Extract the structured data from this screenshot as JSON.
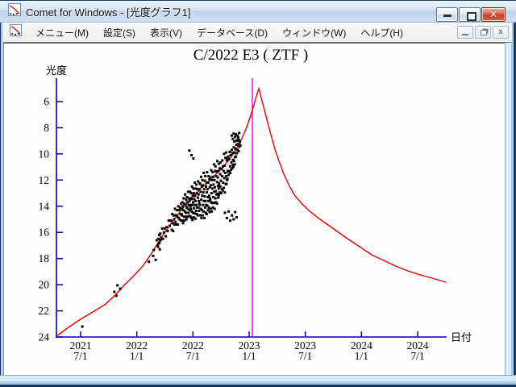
{
  "window": {
    "title": "Comet for Windows - [光度グラフ1]",
    "app_icon": "comet-lightcurve-icon"
  },
  "menu": {
    "items": [
      {
        "label": "メニュー(M)"
      },
      {
        "label": "設定(S)"
      },
      {
        "label": "表示(V)"
      },
      {
        "label": "データベース(D)"
      },
      {
        "label": "ウィンドウ(W)"
      },
      {
        "label": "ヘルプ(H)"
      }
    ]
  },
  "colors": {
    "titlebar_gradient_top": "#eaf3fc",
    "titlebar_gradient_bottom": "#bed4ec",
    "close_button": "#c93f27",
    "menubar_bg": "#f4f3f2",
    "client_bg": "#fefefe",
    "frame_blue": "#a9c7e2"
  },
  "chart_data": {
    "type": "scatter",
    "title": "C/2022 E3 ( ZTF )",
    "xlabel": "日付",
    "ylabel": "光度",
    "x_unit": "decimal_year",
    "xlim": [
      2021.285,
      2024.758
    ],
    "ylim_mag": [
      24.06,
      4.21
    ],
    "grid": false,
    "legend": "none",
    "axis_color": "#0000bb",
    "curve_color": "#e10000",
    "marker_color": "#000000",
    "y_ticks": [
      6,
      8,
      10,
      12,
      14,
      16,
      18,
      20,
      22,
      24
    ],
    "x_ticks": [
      {
        "t": 2021.5,
        "line1": "2021",
        "line2": "7/1"
      },
      {
        "t": 2022.0,
        "line1": "2022",
        "line2": "1/1"
      },
      {
        "t": 2022.5,
        "line1": "2022",
        "line2": "7/1"
      },
      {
        "t": 2023.0,
        "line1": "2023",
        "line2": "1/1"
      },
      {
        "t": 2023.5,
        "line1": "2023",
        "line2": "7/1"
      },
      {
        "t": 2024.0,
        "line1": "2024",
        "line2": "1/1"
      },
      {
        "t": 2024.5,
        "line1": "2024",
        "line2": "7/1"
      }
    ],
    "perihelion_line": {
      "t": 2023.029,
      "color": "#ff00ff"
    },
    "model_curve": [
      [
        2021.285,
        23.94
      ],
      [
        2021.392,
        23.26
      ],
      [
        2021.5,
        22.64
      ],
      [
        2021.608,
        22.09
      ],
      [
        2021.715,
        21.53
      ],
      [
        2021.809,
        20.79
      ],
      [
        2021.895,
        19.99
      ],
      [
        2021.981,
        19.25
      ],
      [
        2022.06,
        18.51
      ],
      [
        2022.132,
        17.59
      ],
      [
        2022.189,
        16.79
      ],
      [
        2022.246,
        16.05
      ],
      [
        2022.311,
        15.25
      ],
      [
        2022.376,
        14.51
      ],
      [
        2022.44,
        13.83
      ],
      [
        2022.505,
        13.21
      ],
      [
        2022.569,
        12.66
      ],
      [
        2022.634,
        12.17
      ],
      [
        2022.698,
        11.61
      ],
      [
        2022.763,
        11.06
      ],
      [
        2022.828,
        10.38
      ],
      [
        2022.885,
        9.64
      ],
      [
        2022.935,
        8.84
      ],
      [
        2022.978,
        7.97
      ],
      [
        2023.014,
        7.05
      ],
      [
        2023.043,
        6.25
      ],
      [
        2023.065,
        5.57
      ],
      [
        2023.086,
        5.01
      ],
      [
        2023.108,
        5.69
      ],
      [
        2023.136,
        6.62
      ],
      [
        2023.165,
        7.6
      ],
      [
        2023.194,
        8.53
      ],
      [
        2023.23,
        9.64
      ],
      [
        2023.266,
        10.56
      ],
      [
        2023.309,
        11.55
      ],
      [
        2023.359,
        12.47
      ],
      [
        2023.409,
        13.21
      ],
      [
        2023.466,
        13.77
      ],
      [
        2023.531,
        14.32
      ],
      [
        2023.603,
        14.82
      ],
      [
        2023.682,
        15.31
      ],
      [
        2023.775,
        15.86
      ],
      [
        2023.876,
        16.48
      ],
      [
        2023.983,
        17.1
      ],
      [
        2024.091,
        17.71
      ],
      [
        2024.199,
        18.15
      ],
      [
        2024.306,
        18.58
      ],
      [
        2024.414,
        18.95
      ],
      [
        2024.522,
        19.25
      ],
      [
        2024.63,
        19.5
      ],
      [
        2024.752,
        19.81
      ]
    ],
    "observations": [
      [
        2021.515,
        23.2
      ],
      [
        2021.8,
        20.55
      ],
      [
        2021.828,
        20.05
      ],
      [
        2021.852,
        20.3
      ],
      [
        2021.818,
        20.85
      ],
      [
        2022.108,
        18.25
      ],
      [
        2022.146,
        17.8
      ],
      [
        2022.168,
        18.1
      ],
      [
        2022.152,
        17.35
      ],
      [
        2022.185,
        17.0
      ],
      [
        2022.177,
        16.6
      ],
      [
        2022.19,
        17.1
      ],
      [
        2022.197,
        16.85
      ],
      [
        2022.205,
        17.3
      ],
      [
        2022.212,
        16.6
      ],
      [
        2022.2,
        16.2
      ],
      [
        2022.192,
        16.5
      ],
      [
        2022.201,
        16.8
      ],
      [
        2022.209,
        16.1
      ],
      [
        2022.218,
        16.4
      ],
      [
        2022.226,
        15.7
      ],
      [
        2022.233,
        16.5
      ],
      [
        2022.241,
        16.0
      ],
      [
        2022.249,
        15.7
      ],
      [
        2022.258,
        16.3
      ],
      [
        2022.266,
        15.6
      ],
      [
        2022.275,
        15.9
      ],
      [
        2022.284,
        15.1
      ],
      [
        2022.293,
        15.5
      ],
      [
        2022.304,
        15.1
      ],
      [
        2022.312,
        15.8
      ],
      [
        2022.316,
        14.6
      ],
      [
        2022.32,
        15.3
      ],
      [
        2022.324,
        15.9
      ],
      [
        2022.328,
        14.7
      ],
      [
        2022.332,
        15.0
      ],
      [
        2022.336,
        15.4
      ],
      [
        2022.34,
        14.2
      ],
      [
        2022.345,
        15.2
      ],
      [
        2022.349,
        14.7
      ],
      [
        2022.353,
        15.4
      ],
      [
        2022.357,
        14.3
      ],
      [
        2022.361,
        14.8
      ],
      [
        2022.365,
        15.4
      ],
      [
        2022.369,
        14.0
      ],
      [
        2022.373,
        14.9
      ],
      [
        2022.377,
        14.3
      ],
      [
        2022.381,
        15.0
      ],
      [
        2022.385,
        14.1
      ],
      [
        2022.389,
        14.6
      ],
      [
        2022.392,
        15.1
      ],
      [
        2022.395,
        13.8
      ],
      [
        2022.398,
        14.6
      ],
      [
        2022.4,
        14.2
      ],
      [
        2022.402,
        14.7
      ],
      [
        2022.405,
        13.7
      ],
      [
        2022.407,
        15.1
      ],
      [
        2022.41,
        14.0
      ],
      [
        2022.412,
        15.3
      ],
      [
        2022.415,
        14.3
      ],
      [
        2022.417,
        13.4
      ],
      [
        2022.42,
        14.8
      ],
      [
        2022.422,
        13.8
      ],
      [
        2022.425,
        15.1
      ],
      [
        2022.427,
        14.4
      ],
      [
        2022.43,
        13.1
      ],
      [
        2022.432,
        14.8
      ],
      [
        2022.435,
        13.9
      ],
      [
        2022.437,
        14.5
      ],
      [
        2022.44,
        13.5
      ],
      [
        2022.442,
        15.0
      ],
      [
        2022.445,
        14.1
      ],
      [
        2022.447,
        13.3
      ],
      [
        2022.45,
        14.8
      ],
      [
        2022.452,
        13.7
      ],
      [
        2022.455,
        14.2
      ],
      [
        2022.457,
        12.9
      ],
      [
        2022.46,
        14.5
      ],
      [
        2022.462,
        13.9
      ],
      [
        2022.465,
        13.4
      ],
      [
        2022.467,
        14.75
      ],
      [
        2022.47,
        13.6
      ],
      [
        2022.472,
        14.3
      ],
      [
        2022.475,
        12.9
      ],
      [
        2022.477,
        14.0
      ],
      [
        2022.479,
        14.8
      ],
      [
        2022.48,
        13.4
      ],
      [
        2022.481,
        13.9
      ],
      [
        2022.468,
        9.75
      ],
      [
        2022.487,
        10.1
      ],
      [
        2022.503,
        10.35
      ],
      [
        2022.482,
        14.2
      ],
      [
        2022.484,
        13.0
      ],
      [
        2022.486,
        14.9
      ],
      [
        2022.488,
        13.45
      ],
      [
        2022.49,
        14.4
      ],
      [
        2022.492,
        12.5
      ],
      [
        2022.494,
        13.9
      ],
      [
        2022.496,
        15.05
      ],
      [
        2022.498,
        13.2
      ],
      [
        2022.5,
        14.5
      ],
      [
        2022.502,
        13.7
      ],
      [
        2022.504,
        12.65
      ],
      [
        2022.506,
        14.85
      ],
      [
        2022.508,
        13.0
      ],
      [
        2022.51,
        14.15
      ],
      [
        2022.512,
        13.45
      ],
      [
        2022.514,
        14.55
      ],
      [
        2022.516,
        12.2
      ],
      [
        2022.518,
        13.9
      ],
      [
        2022.52,
        13.2
      ],
      [
        2022.522,
        14.95
      ],
      [
        2022.524,
        13.6
      ],
      [
        2022.526,
        12.65
      ],
      [
        2022.528,
        14.35
      ],
      [
        2022.53,
        12.35
      ],
      [
        2022.532,
        13.9
      ],
      [
        2022.534,
        14.6
      ],
      [
        2022.536,
        13.0
      ],
      [
        2022.538,
        14.1
      ],
      [
        2022.54,
        12.7
      ],
      [
        2022.542,
        14.7
      ],
      [
        2022.544,
        13.35
      ],
      [
        2022.546,
        12.1
      ],
      [
        2022.548,
        14.1
      ],
      [
        2022.55,
        13.1
      ],
      [
        2022.552,
        13.6
      ],
      [
        2022.554,
        14.35
      ],
      [
        2022.556,
        12.7
      ],
      [
        2022.558,
        13.8
      ],
      [
        2022.56,
        12.25
      ],
      [
        2022.562,
        13.9
      ],
      [
        2022.564,
        12.3
      ],
      [
        2022.566,
        14.7
      ],
      [
        2022.568,
        12.9
      ],
      [
        2022.57,
        14.2
      ],
      [
        2022.572,
        11.75
      ],
      [
        2022.574,
        13.5
      ],
      [
        2022.576,
        14.9
      ],
      [
        2022.578,
        12.5
      ],
      [
        2022.58,
        14.3
      ],
      [
        2022.582,
        13.2
      ],
      [
        2022.584,
        12.0
      ],
      [
        2022.586,
        14.7
      ],
      [
        2022.588,
        12.4
      ],
      [
        2022.59,
        13.9
      ],
      [
        2022.592,
        12.95
      ],
      [
        2022.594,
        14.4
      ],
      [
        2022.596,
        11.45
      ],
      [
        2022.598,
        13.6
      ],
      [
        2022.6,
        12.7
      ],
      [
        2022.602,
        14.9
      ],
      [
        2022.604,
        13.25
      ],
      [
        2022.606,
        12.05
      ],
      [
        2022.608,
        14.1
      ],
      [
        2022.61,
        11.7
      ],
      [
        2022.612,
        13.6
      ],
      [
        2022.614,
        14.5
      ],
      [
        2022.616,
        12.5
      ],
      [
        2022.618,
        13.9
      ],
      [
        2022.62,
        12.2
      ],
      [
        2022.622,
        14.6
      ],
      [
        2022.624,
        12.95
      ],
      [
        2022.626,
        11.4
      ],
      [
        2022.628,
        13.95
      ],
      [
        2022.63,
        12.7
      ],
      [
        2022.632,
        13.3
      ],
      [
        2022.634,
        14.3
      ],
      [
        2022.636,
        12.2
      ],
      [
        2022.638,
        13.6
      ],
      [
        2022.64,
        11.7
      ],
      [
        2022.642,
        14.1
      ],
      [
        2022.644,
        13.2
      ],
      [
        2022.646,
        11.95
      ],
      [
        2022.648,
        14.45
      ],
      [
        2022.65,
        12.55
      ],
      [
        2022.651,
        13.4
      ],
      [
        2022.653,
        13.5
      ],
      [
        2022.655,
        11.8
      ],
      [
        2022.657,
        14.2
      ],
      [
        2022.659,
        12.4
      ],
      [
        2022.661,
        13.7
      ],
      [
        2022.663,
        11.25
      ],
      [
        2022.665,
        13.0
      ],
      [
        2022.667,
        14.4
      ],
      [
        2022.669,
        12.0
      ],
      [
        2022.671,
        13.75
      ],
      [
        2022.673,
        12.65
      ],
      [
        2022.675,
        11.4
      ],
      [
        2022.677,
        14.1
      ],
      [
        2022.679,
        11.75
      ],
      [
        2022.681,
        13.3
      ],
      [
        2022.683,
        12.35
      ],
      [
        2022.685,
        13.75
      ],
      [
        2022.687,
        10.8
      ],
      [
        2022.689,
        12.9
      ],
      [
        2022.691,
        12.0
      ],
      [
        2022.693,
        14.2
      ],
      [
        2022.695,
        12.55
      ],
      [
        2022.697,
        11.3
      ],
      [
        2022.699,
        13.4
      ],
      [
        2022.701,
        10.95
      ],
      [
        2022.703,
        12.85
      ],
      [
        2022.705,
        13.7
      ],
      [
        2022.707,
        11.7
      ],
      [
        2022.709,
        13.1
      ],
      [
        2022.711,
        11.35
      ],
      [
        2022.713,
        13.8
      ],
      [
        2022.715,
        12.15
      ],
      [
        2022.717,
        10.55
      ],
      [
        2022.719,
        13.05
      ],
      [
        2022.721,
        11.8
      ],
      [
        2022.723,
        12.45
      ],
      [
        2022.725,
        13.35
      ],
      [
        2022.727,
        11.3
      ],
      [
        2022.729,
        12.65
      ],
      [
        2022.73,
        10.75
      ],
      [
        2022.731,
        13.15
      ],
      [
        2022.732,
        12.25
      ],
      [
        2022.734,
        12.45
      ],
      [
        2022.737,
        11.1
      ],
      [
        2022.739,
        12.95
      ],
      [
        2022.742,
        11.55
      ],
      [
        2022.744,
        12.5
      ],
      [
        2022.747,
        10.65
      ],
      [
        2022.749,
        12.05
      ],
      [
        2022.752,
        13.0
      ],
      [
        2022.754,
        11.15
      ],
      [
        2022.757,
        12.7
      ],
      [
        2022.759,
        11.7
      ],
      [
        2022.762,
        10.5
      ],
      [
        2022.764,
        12.8
      ],
      [
        2022.767,
        10.95
      ],
      [
        2022.769,
        12.2
      ],
      [
        2022.772,
        11.3
      ],
      [
        2022.774,
        12.6
      ],
      [
        2022.777,
        10.0
      ],
      [
        2022.779,
        11.85
      ],
      [
        2022.782,
        10.9
      ],
      [
        2022.784,
        12.95
      ],
      [
        2022.787,
        11.45
      ],
      [
        2022.789,
        10.3
      ],
      [
        2022.792,
        12.3
      ],
      [
        2022.794,
        9.9
      ],
      [
        2022.797,
        11.7
      ],
      [
        2022.799,
        12.3
      ],
      [
        2022.801,
        10.5
      ],
      [
        2022.803,
        12.0
      ],
      [
        2022.805,
        10.3
      ],
      [
        2022.807,
        11.9
      ],
      [
        2022.809,
        11.35
      ],
      [
        2022.812,
        11.3
      ],
      [
        2022.815,
        10.2
      ],
      [
        2022.818,
        11.6
      ],
      [
        2022.821,
        10.4
      ],
      [
        2022.824,
        11.35
      ],
      [
        2022.827,
        9.85
      ],
      [
        2022.83,
        10.95
      ],
      [
        2022.833,
        11.45
      ],
      [
        2022.836,
        10.1
      ],
      [
        2022.839,
        11.2
      ],
      [
        2022.842,
        10.65
      ],
      [
        2022.845,
        9.7
      ],
      [
        2022.848,
        11.1
      ],
      [
        2022.851,
        9.95
      ],
      [
        2022.854,
        10.85
      ],
      [
        2022.857,
        10.45
      ],
      [
        2022.86,
        11.0
      ],
      [
        2022.863,
        9.5
      ],
      [
        2022.866,
        10.55
      ],
      [
        2022.869,
        9.9
      ],
      [
        2022.872,
        10.8
      ],
      [
        2022.875,
        10.25
      ],
      [
        2022.878,
        9.6
      ],
      [
        2022.882,
        10.2
      ],
      [
        2022.886,
        9.3
      ],
      [
        2022.89,
        9.95
      ],
      [
        2022.894,
        9.0
      ],
      [
        2022.898,
        9.7
      ],
      [
        2022.902,
        9.25
      ],
      [
        2022.906,
        9.8
      ],
      [
        2022.91,
        8.95
      ],
      [
        2022.914,
        9.45
      ],
      [
        2022.918,
        9.1
      ],
      [
        2022.922,
        9.35
      ],
      [
        2022.845,
        8.6
      ],
      [
        2022.855,
        8.85
      ],
      [
        2022.862,
        8.45
      ],
      [
        2022.868,
        9.05
      ],
      [
        2022.875,
        8.7
      ],
      [
        2022.882,
        8.5
      ],
      [
        2022.889,
        8.95
      ],
      [
        2022.896,
        8.6
      ],
      [
        2022.904,
        8.75
      ],
      [
        2022.912,
        8.4
      ],
      [
        2022.785,
        14.5
      ],
      [
        2022.802,
        14.9
      ],
      [
        2022.818,
        14.4
      ],
      [
        2022.832,
        15.1
      ],
      [
        2022.848,
        14.7
      ],
      [
        2022.862,
        15.0
      ],
      [
        2022.876,
        14.45
      ],
      [
        2022.888,
        14.85
      ]
    ]
  }
}
